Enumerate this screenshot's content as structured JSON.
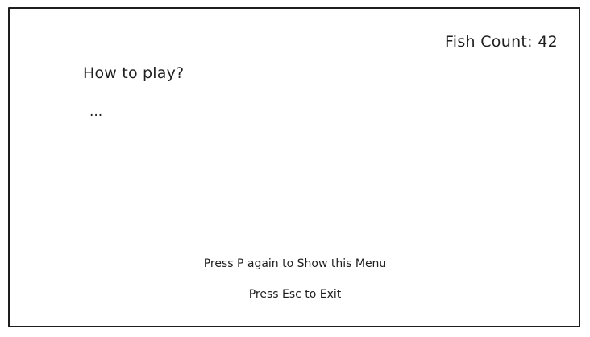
{
  "hud": {
    "fish_count_label": "Fish Count: 42"
  },
  "help": {
    "title": "How to play?",
    "body": "..."
  },
  "footer": {
    "menu_hint": "Press P again to Show this Menu",
    "exit_hint": "Press Esc to Exit"
  },
  "colors": {
    "stroke": "#1e1e1e",
    "background": "#ffffff"
  }
}
